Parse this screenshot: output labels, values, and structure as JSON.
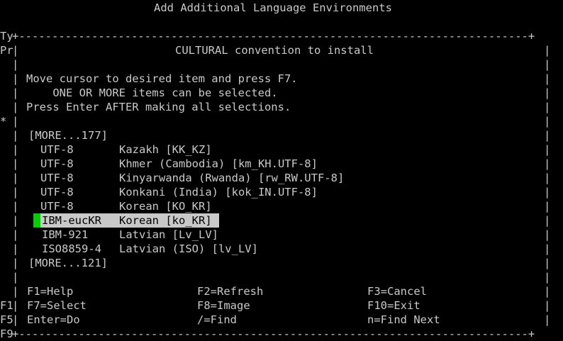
{
  "screen_title": "Add Additional Language Environments",
  "background_left_labels": {
    "row3": "Ty",
    "row4": "Pr",
    "row9": "*",
    "row22": "F1",
    "row23": "F5",
    "row24": "F9"
  },
  "dialog": {
    "title": "CULTURAL convention to install",
    "instructions": [
      "Move cursor to desired item and press F7.",
      "    ONE OR MORE items can be selected.",
      "Press Enter AFTER making all selections."
    ],
    "more_top": "[MORE...177]",
    "items": [
      {
        "codeset": "UTF-8",
        "name": "Kazakh [KK_KZ]"
      },
      {
        "codeset": "UTF-8",
        "name": "Khmer (Cambodia) [km_KH.UTF-8]"
      },
      {
        "codeset": "UTF-8",
        "name": "Kinyarwanda (Rwanda) [rw_RW.UTF-8]"
      },
      {
        "codeset": "UTF-8",
        "name": "Konkani (India) [kok_IN.UTF-8]"
      },
      {
        "codeset": "UTF-8",
        "name": "Korean [KO_KR]"
      },
      {
        "codeset": "IBM-eucKR",
        "name": "Korean [ko_KR]"
      },
      {
        "codeset": "IBM-921",
        "name": "Latvian [Lv_LV]"
      },
      {
        "codeset": "ISO8859-4",
        "name": "Latvian (ISO) [lv_LV]"
      }
    ],
    "more_bottom": "[MORE...121]",
    "function_keys": [
      {
        "key": "F1=Help",
        "col": 0
      },
      {
        "key": "F2=Refresh",
        "col": 1
      },
      {
        "key": "F3=Cancel",
        "col": 2
      },
      {
        "key": "F7=Select",
        "col": 0
      },
      {
        "key": "F8=Image",
        "col": 1
      },
      {
        "key": "F10=Exit",
        "col": 2
      },
      {
        "key": "Enter=Do",
        "col": 0
      },
      {
        "key": "/=Find",
        "col": 1
      },
      {
        "key": "n=Find Next",
        "col": 2
      }
    ]
  },
  "colors": {
    "background": "#000000",
    "text": "#c9c9c9",
    "highlight": "#c9c9c9",
    "cursor": "#00d000"
  }
}
